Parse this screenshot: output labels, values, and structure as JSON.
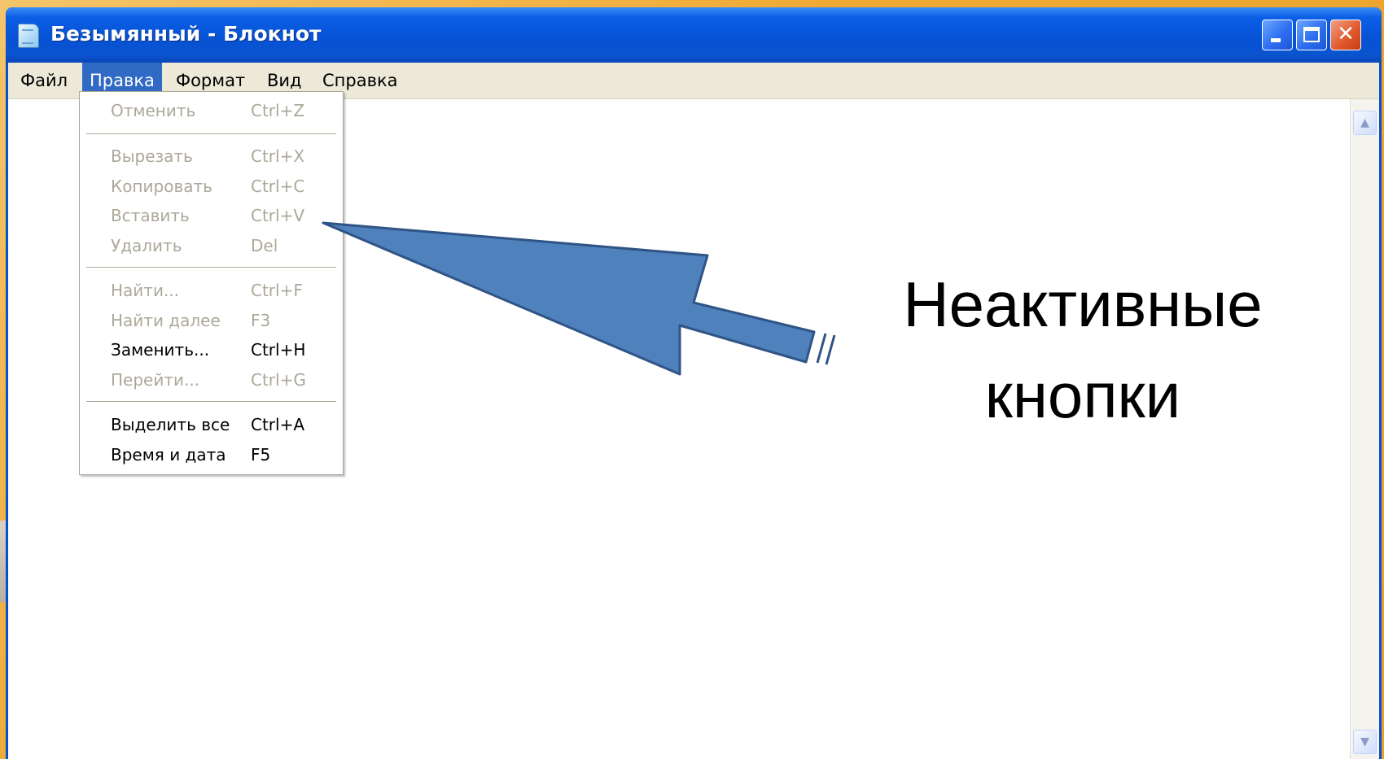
{
  "window": {
    "title": "Безымянный - Блокнот",
    "close_glyph": "✕",
    "icons": {
      "app": "notepad-icon",
      "minimize": "minimize-icon",
      "maximize": "maximize-icon",
      "close": "close-icon"
    }
  },
  "menubar": {
    "items": [
      "Файл",
      "Правка",
      "Формат",
      "Вид",
      "Справка"
    ],
    "active_item": "Правка"
  },
  "edit_menu": {
    "items": [
      {
        "label": "Отменить",
        "shortcut": "Ctrl+Z",
        "enabled": false
      },
      {
        "label": "Вырезать",
        "shortcut": "Ctrl+X",
        "enabled": false
      },
      {
        "label": "Копировать",
        "shortcut": "Ctrl+C",
        "enabled": false
      },
      {
        "label": "Вставить",
        "shortcut": "Ctrl+V",
        "enabled": false
      },
      {
        "label": "Удалить",
        "shortcut": "Del",
        "enabled": false
      },
      {
        "label": "Найти...",
        "shortcut": "Ctrl+F",
        "enabled": false
      },
      {
        "label": "Найти далее",
        "shortcut": "F3",
        "enabled": false
      },
      {
        "label": "Заменить...",
        "shortcut": "Ctrl+H",
        "enabled": true
      },
      {
        "label": "Перейти...",
        "shortcut": "Ctrl+G",
        "enabled": false
      },
      {
        "label": "Выделить все",
        "shortcut": "Ctrl+A",
        "enabled": true
      },
      {
        "label": "Время и дата",
        "shortcut": "F5",
        "enabled": true
      }
    ]
  },
  "scrollbar": {
    "up_glyph": "▲",
    "down_glyph": "▼"
  },
  "annotation": {
    "line1": "Неактивные",
    "line2": "кнопки",
    "arrow_color": "#4f81bd"
  }
}
